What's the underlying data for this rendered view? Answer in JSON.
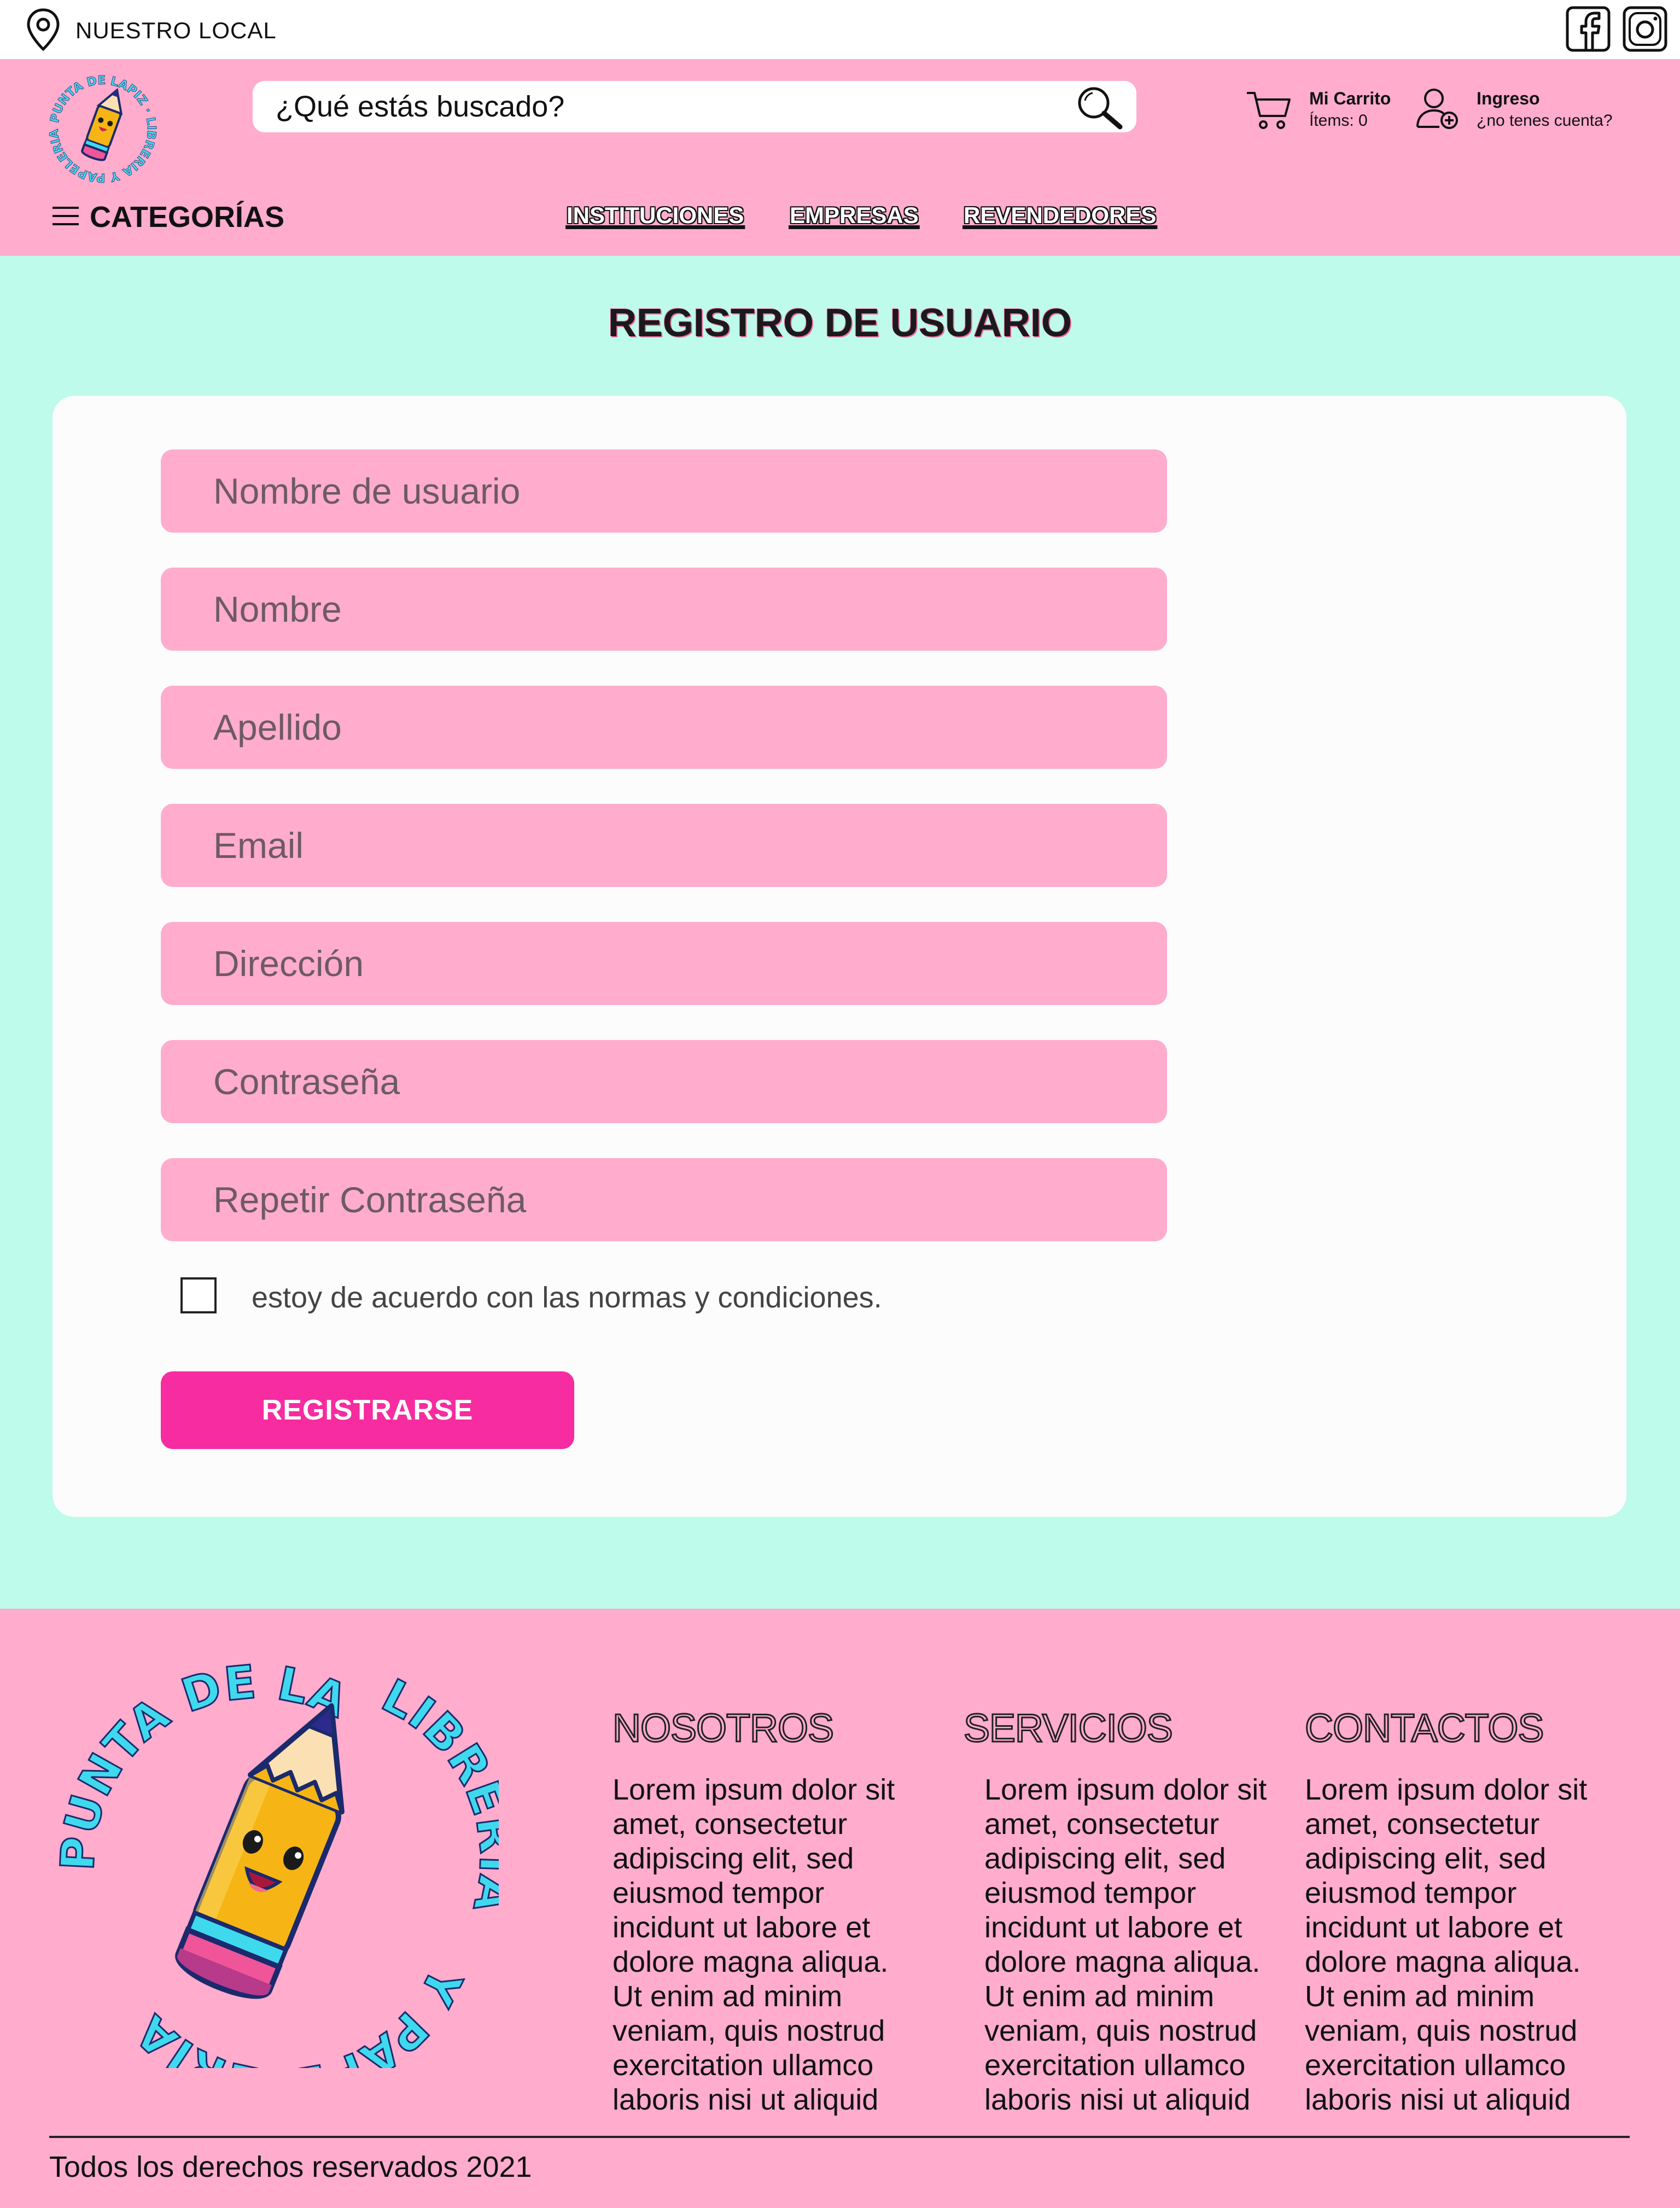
{
  "topbar": {
    "location_label": "NUESTRO LOCAL",
    "location_icon": "map-pin-icon",
    "social_icons": [
      "facebook-icon",
      "instagram-icon"
    ]
  },
  "header": {
    "search_placeholder": "¿Qué estás buscado?",
    "search_icon": "search-icon",
    "cart": {
      "title": "Mi Carrito",
      "items": "Ítems: 0",
      "icon": "cart-icon"
    },
    "login": {
      "title": "Ingreso",
      "subtitle": "¿no tenes cuenta?",
      "icon": "user-add-icon"
    },
    "categories_label": "CATEGORÍAS",
    "nav": [
      "INSTITUCIONES",
      "EMPRESAS",
      "REVENDEDORES"
    ],
    "logo_text": "PUNTA DE LAPIZ · LIBRERIA Y PAPELERIA"
  },
  "form": {
    "title": "REGISTRO DE USUARIO",
    "fields": [
      "Nombre de usuario",
      "Nombre",
      "Apellido",
      "Email",
      "Dirección",
      "Contraseña",
      "Repetir Contraseña"
    ],
    "terms_label": "estoy de acuerdo con las normas y condiciones.",
    "submit_label": "REGISTRARSE"
  },
  "footer": {
    "logo_text_top": "PUNTA DE LAPIZ",
    "logo_text_right": "LIBRERIA",
    "logo_text_bottom": "Y PAPELERIA",
    "columns": [
      {
        "title": "NOSOTROS",
        "text": "Lorem ipsum dolor sit amet, consectetur adipiscing elit, sed eiusmod tempor incidunt ut labore et dolore magna aliqua. Ut enim ad minim veniam, quis nostrud exercitation ullamco laboris nisi ut aliquid"
      },
      {
        "title": "SERVICIOS",
        "text": "Lorem ipsum dolor sit amet, consectetur adipiscing elit, sed eiusmod tempor incidunt ut labore et dolore magna aliqua. Ut enim ad minim veniam, quis nostrud exercitation ullamco laboris nisi ut aliquid"
      },
      {
        "title": "CONTACTOS",
        "text": "Lorem ipsum dolor sit amet, consectetur adipiscing elit, sed eiusmod tempor incidunt ut labore et dolore magna aliqua. Ut enim ad minim veniam, quis nostrud exercitation ullamco laboris nisi ut aliquid"
      }
    ],
    "copyright": "Todos los derechos reservados 2021"
  },
  "colors": {
    "pink": "#ffaccd",
    "mint": "#befbea",
    "button": "#f62ca0",
    "logo_text": "#3fd9ee"
  }
}
